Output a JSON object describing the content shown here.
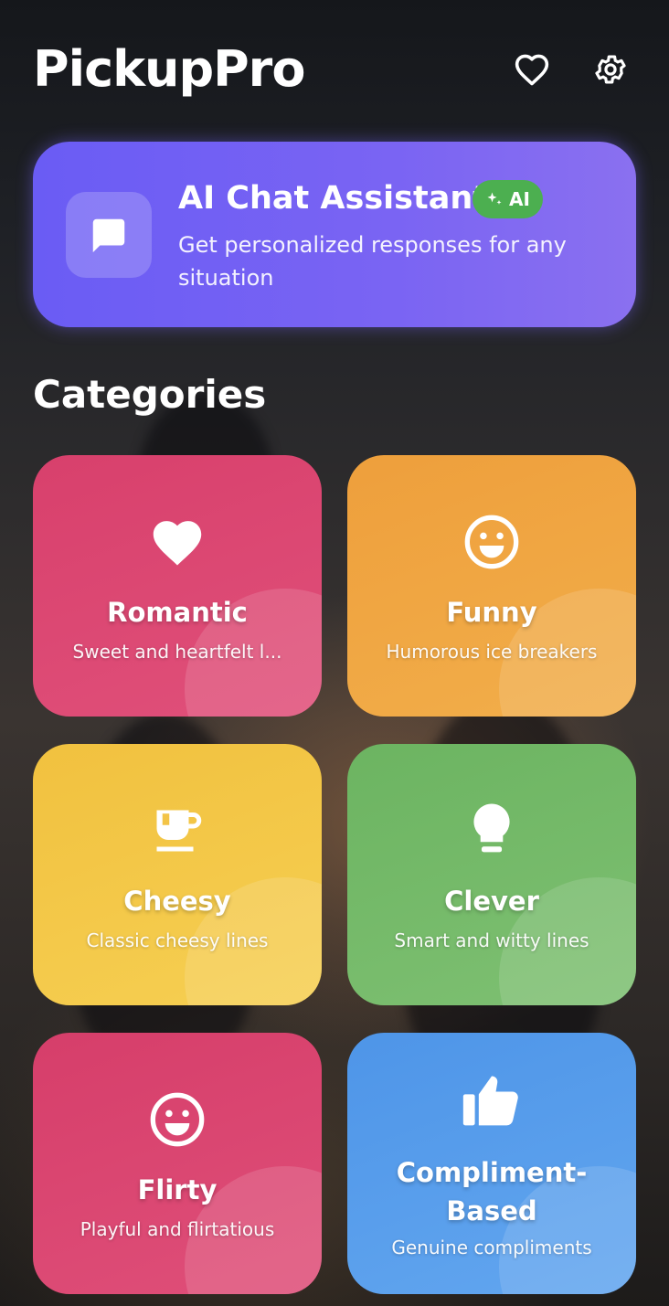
{
  "app": {
    "title": "PickupPro"
  },
  "header": {
    "favorites_icon": "heart-outline-icon",
    "settings_icon": "gear-icon"
  },
  "ai_card": {
    "title": "AI Chat Assistant",
    "badge": "AI",
    "subtitle": "Get personalized responses for any situation",
    "icon": "chat-bubble-icon",
    "color": "#6a5cf4"
  },
  "section": {
    "title": "Categories"
  },
  "categories": [
    {
      "title": "Romantic",
      "description": "Sweet and heartfelt l...",
      "icon": "heart-icon",
      "color": "#d8406c"
    },
    {
      "title": "Funny",
      "description": "Humorous ice breakers",
      "icon": "smiley-icon",
      "color": "#ee9f3c"
    },
    {
      "title": "Cheesy",
      "description": "Classic cheesy lines",
      "icon": "coffee-cup-icon",
      "color": "#f1c13f"
    },
    {
      "title": "Clever",
      "description": "Smart and witty lines",
      "icon": "lightbulb-icon",
      "color": "#6cb461"
    },
    {
      "title": "Flirty",
      "description": "Playful and flirtatious",
      "icon": "smiley-icon",
      "color": "#d63e6a"
    },
    {
      "title": "Compliment-Based",
      "title_line1": "Compliment-",
      "title_line2": "Based",
      "description": "Genuine compliments",
      "icon": "thumbs-up-icon",
      "color": "#4e95e8"
    }
  ]
}
